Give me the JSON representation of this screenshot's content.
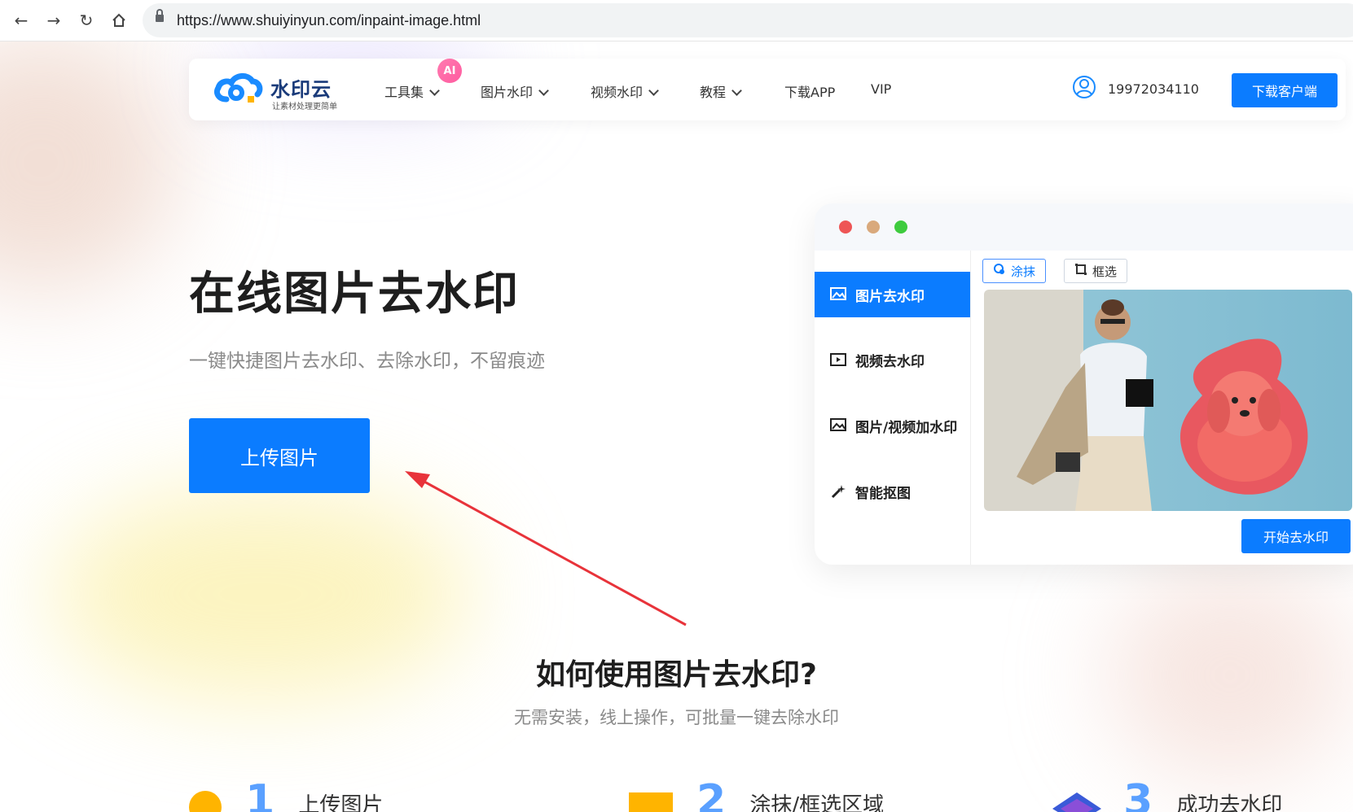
{
  "browser": {
    "url": "https://www.shuiyinyun.com/inpaint-image.html"
  },
  "header": {
    "logo_text": "水印云",
    "logo_sub": "让素材处理更简单",
    "ai_badge": "AI",
    "nav": [
      {
        "label": "工具集",
        "dropdown": true
      },
      {
        "label": "图片水印",
        "dropdown": true
      },
      {
        "label": "视频水印",
        "dropdown": true
      },
      {
        "label": "教程",
        "dropdown": true
      },
      {
        "label": "下载APP",
        "dropdown": false
      },
      {
        "label": "VIP",
        "dropdown": false
      }
    ],
    "user_phone": "19972034110",
    "download_client": "下载客户端"
  },
  "hero": {
    "title": "在线图片去水印",
    "subtitle": "一键快捷图片去水印、去除水印，不留痕迹",
    "upload_button": "上传图片"
  },
  "preview": {
    "side_items": [
      {
        "label": "图片去水印",
        "active": true
      },
      {
        "label": "视频去水印",
        "active": false
      },
      {
        "label": "图片/视频加水印",
        "active": false
      },
      {
        "label": "智能抠图",
        "active": false
      }
    ],
    "tool_smear": "涂抹",
    "tool_box": "框选",
    "start_button": "开始去水印"
  },
  "howto": {
    "title": "如何使用图片去水印?",
    "subtitle": "无需安装，线上操作，可批量一键去除水印",
    "steps": [
      {
        "num": "1",
        "label": "上传图片"
      },
      {
        "num": "2",
        "label": "涂抹/框选区域"
      },
      {
        "num": "3",
        "label": "成功去水印"
      }
    ]
  },
  "colors": {
    "accent": "#0b7cff",
    "annotation_arrow": "#e8333a"
  }
}
